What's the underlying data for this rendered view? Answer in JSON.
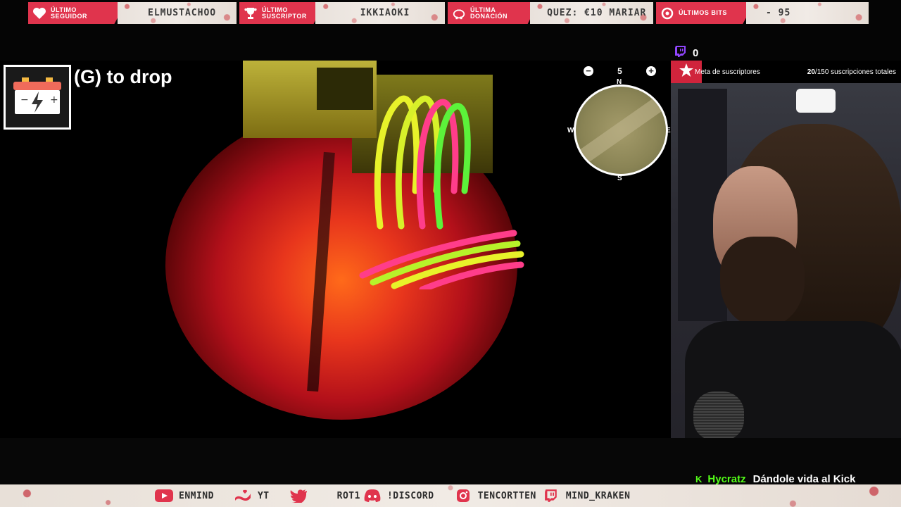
{
  "topbar": {
    "items": [
      {
        "label": "Último\nseguidor",
        "value": "ELMUSTACHOO",
        "icon": "heart-icon"
      },
      {
        "label": "Último\nsuscriptor",
        "value": "IKKIAOKI",
        "icon": "trophy-icon"
      },
      {
        "label": "Última\ndonación",
        "value": "QUEZ: €10   MARIAR",
        "icon": "piggy-bank-icon"
      },
      {
        "label": "Últimos bits",
        "value": "- 95",
        "icon": "bits-icon"
      }
    ]
  },
  "game": {
    "drop_hint": "(G) to drop",
    "held_item_icon": "battery-icon",
    "minimap": {
      "zoom": "5",
      "zoom_out_label": "−",
      "zoom_in_label": "+",
      "north": "N",
      "south": "S",
      "east": "E",
      "west": "W"
    }
  },
  "stream": {
    "viewer_count": "0",
    "viewer_icon": "twitch-icon",
    "sub_goal": {
      "label": "Meta de suscriptores",
      "current": "20",
      "total_text": "/150 suscripciones totales",
      "icon": "star-icon"
    },
    "chat": {
      "platform_badge": "K",
      "user": "Hycratz",
      "message": "Dándole vida al Kick"
    }
  },
  "socials": [
    {
      "icon": "youtube-icon",
      "text": "ENMIND"
    },
    {
      "icon": "heart-hand-icon",
      "text": "YT"
    },
    {
      "icon": "twitter-icon",
      "text": ""
    },
    {
      "icon": "",
      "text": "ROT1"
    },
    {
      "icon": "discord-icon",
      "text": "!DISCORD"
    },
    {
      "icon": "instagram-icon",
      "text": "TENCORTTEN"
    },
    {
      "icon": "twitch-icon",
      "text": "MIND_KRAKEN"
    }
  ],
  "colors": {
    "accent": "#e0344d",
    "kick_green": "#53fc18",
    "twitch_purple": "#9146ff"
  }
}
